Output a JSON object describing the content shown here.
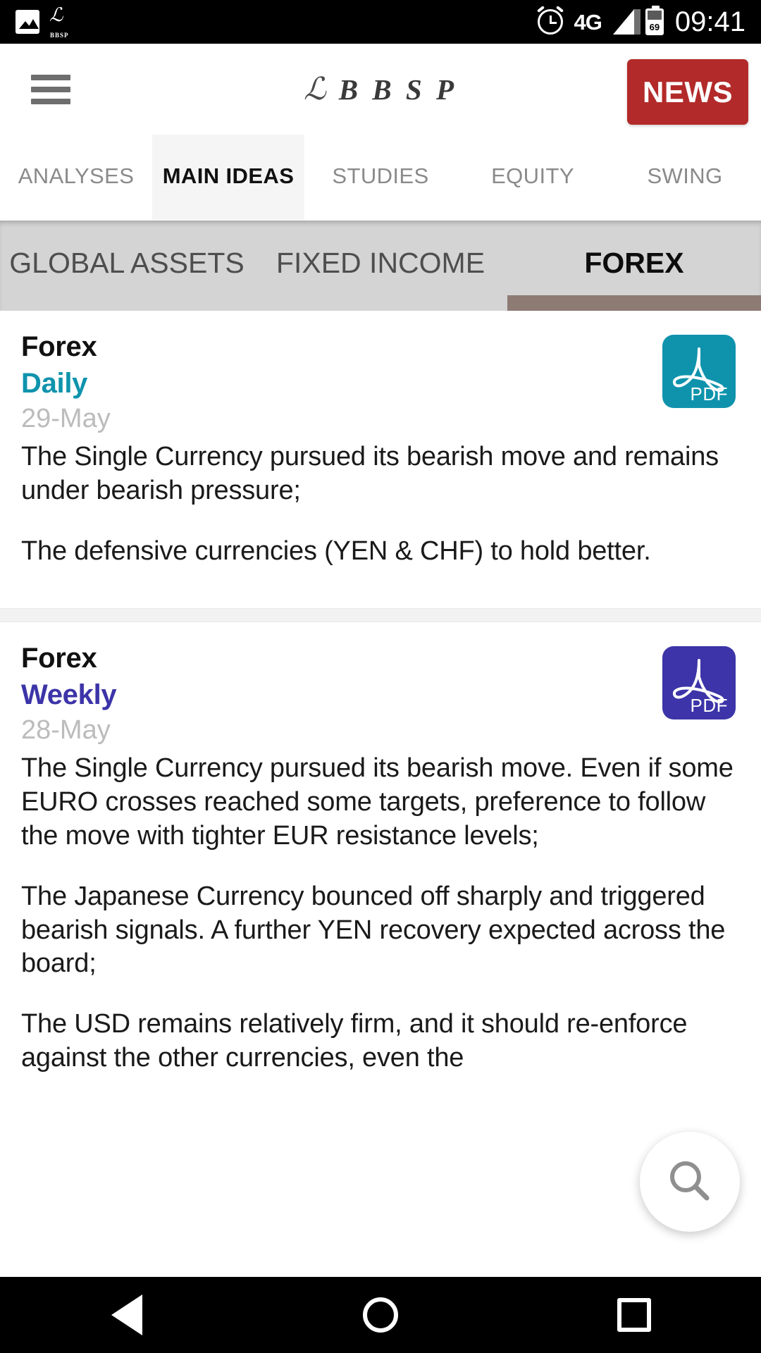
{
  "status_bar": {
    "icons": [
      "photo-icon",
      "bbsp-app-icon",
      "alarm-icon",
      "signal-icon",
      "battery-icon"
    ],
    "network": "4G",
    "battery_level": "69",
    "time": "09:41",
    "app_icon_mark": "ℒ",
    "app_icon_label": "BBSP"
  },
  "header": {
    "menu_label": "menu",
    "brand_mark": "ℒ",
    "brand_text": "B B S P",
    "news_label": "NEWS"
  },
  "primary_tabs": [
    {
      "label": "ANALYSES",
      "active": false
    },
    {
      "label": "MAIN IDEAS",
      "active": true
    },
    {
      "label": "STUDIES",
      "active": false
    },
    {
      "label": "EQUITY",
      "active": false
    },
    {
      "label": "SWING",
      "active": false
    }
  ],
  "secondary_tabs": [
    {
      "label": "GLOBAL ASSETS",
      "active": false
    },
    {
      "label": "FIXED INCOME",
      "active": false
    },
    {
      "label": "FOREX",
      "active": true
    }
  ],
  "colors": {
    "news_red": "#b32a2a",
    "active_underline": "#8d7b74",
    "daily_teal": "#0f93ad",
    "weekly_indigo": "#3c34a8",
    "secondary_tab_bg": "#d4d4d4",
    "date_grey": "#bcbcbc"
  },
  "cards": [
    {
      "title": "Forex",
      "type": "Daily",
      "type_color": "#0f93ad",
      "date": "29-May",
      "pdf_label": "PDF",
      "pdf_color": "#0f93ad",
      "paragraphs": [
        "The Single Currency pursued its bearish move and remains under bearish pressure;",
        "The defensive currencies (YEN & CHF) to hold better."
      ]
    },
    {
      "title": "Forex",
      "type": "Weekly",
      "type_color": "#3c34a8",
      "date": "28-May",
      "pdf_label": "PDF",
      "pdf_color": "#3c34a8",
      "paragraphs": [
        "The Single Currency pursued its bearish move. Even if some EURO crosses reached some targets, preference to follow the move with tighter EUR resistance levels;",
        "The Japanese Currency bounced off sharply and triggered bearish signals. A further YEN recovery expected across the board;",
        "The USD remains relatively firm, and it should re-enforce against the other currencies, even the"
      ]
    }
  ],
  "fab": {
    "icon": "search-icon",
    "label": "Search"
  },
  "nav_bar": {
    "back": "back-icon",
    "home": "home-icon",
    "recent": "recent-apps-icon"
  }
}
